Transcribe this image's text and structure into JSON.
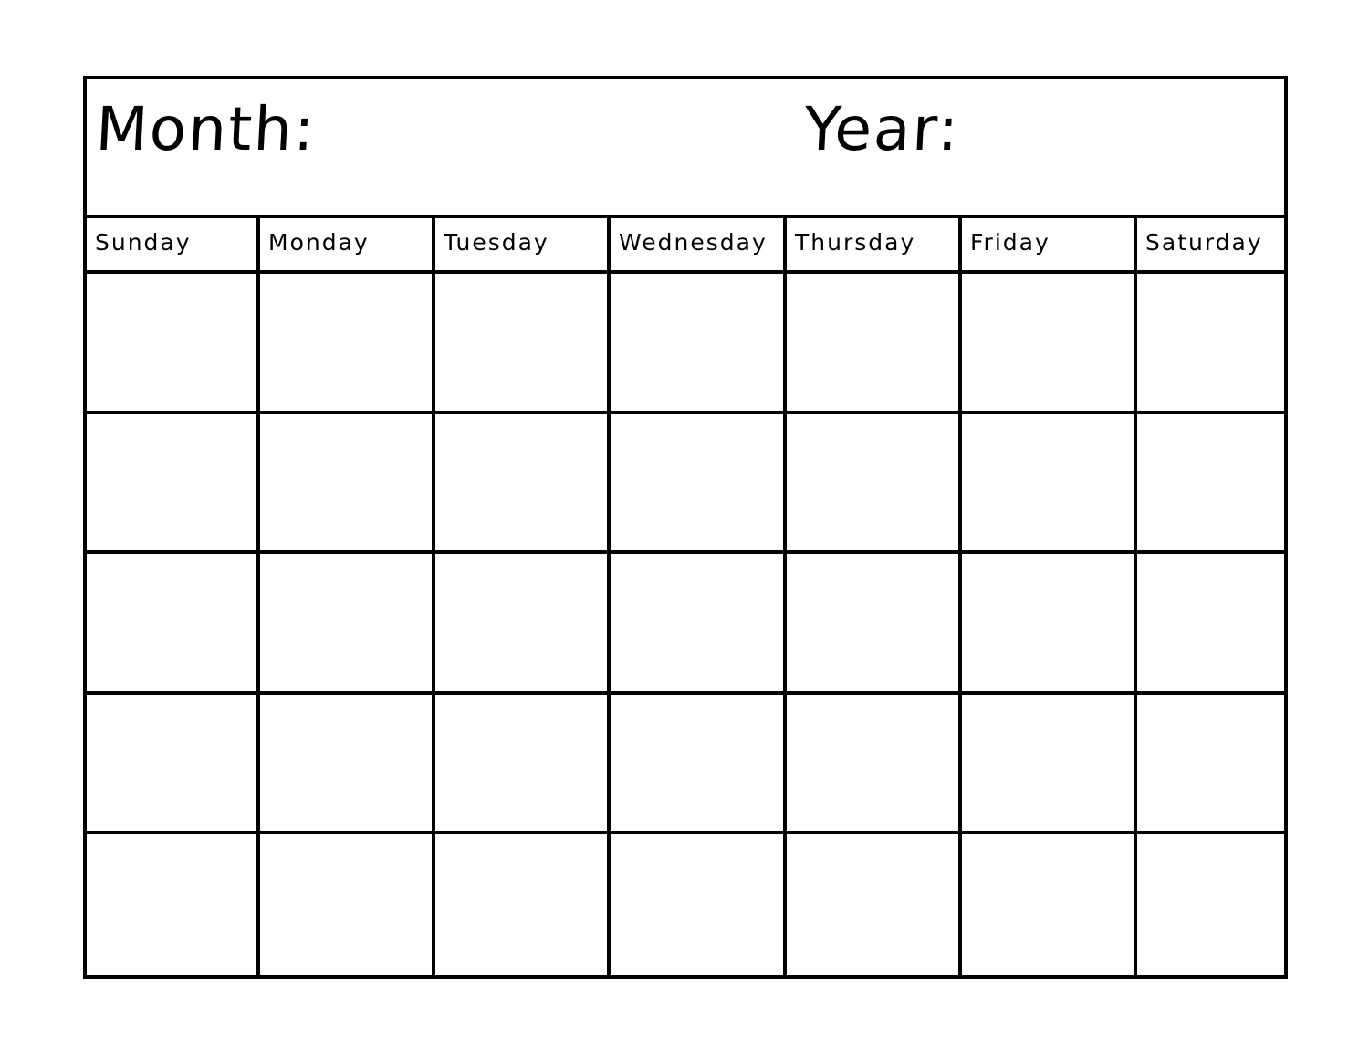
{
  "header": {
    "month_label": "Month:",
    "year_label": "Year:"
  },
  "days": [
    {
      "label": "Sunday"
    },
    {
      "label": "Monday"
    },
    {
      "label": "Tuesday"
    },
    {
      "label": "Wednesday"
    },
    {
      "label": "Thursday"
    },
    {
      "label": "Friday"
    },
    {
      "label": "Saturday"
    }
  ],
  "weeks": 5,
  "colors": {
    "line": "#000000",
    "background": "#ffffff"
  }
}
